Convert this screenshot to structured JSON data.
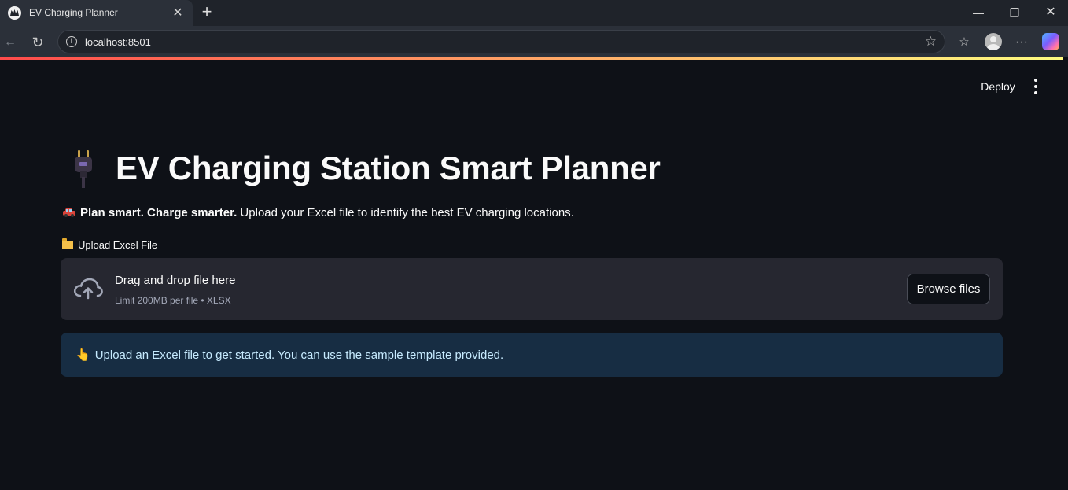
{
  "browser": {
    "tab_title": "EV Charging Planner",
    "address": "localhost:8501"
  },
  "app": {
    "deploy_label": "Deploy",
    "title": "EV Charging Station Smart Planner",
    "tagline_bold": "Plan smart. Charge smarter.",
    "tagline_rest": " Upload your Excel file to identify the best EV charging locations.",
    "upload_label": "Upload Excel File",
    "dropzone": {
      "title": "Drag and drop file here",
      "limit": "Limit 200MB per file • XLSX",
      "browse_label": "Browse files"
    },
    "info_text": "Upload an Excel file to get started. You can use the sample template provided.",
    "colors": {
      "background": "#0e1117",
      "dropzone": "#262730",
      "info_bg": "#172d43",
      "info_text": "#c7ebff",
      "accent": "#ff4b4b"
    }
  }
}
